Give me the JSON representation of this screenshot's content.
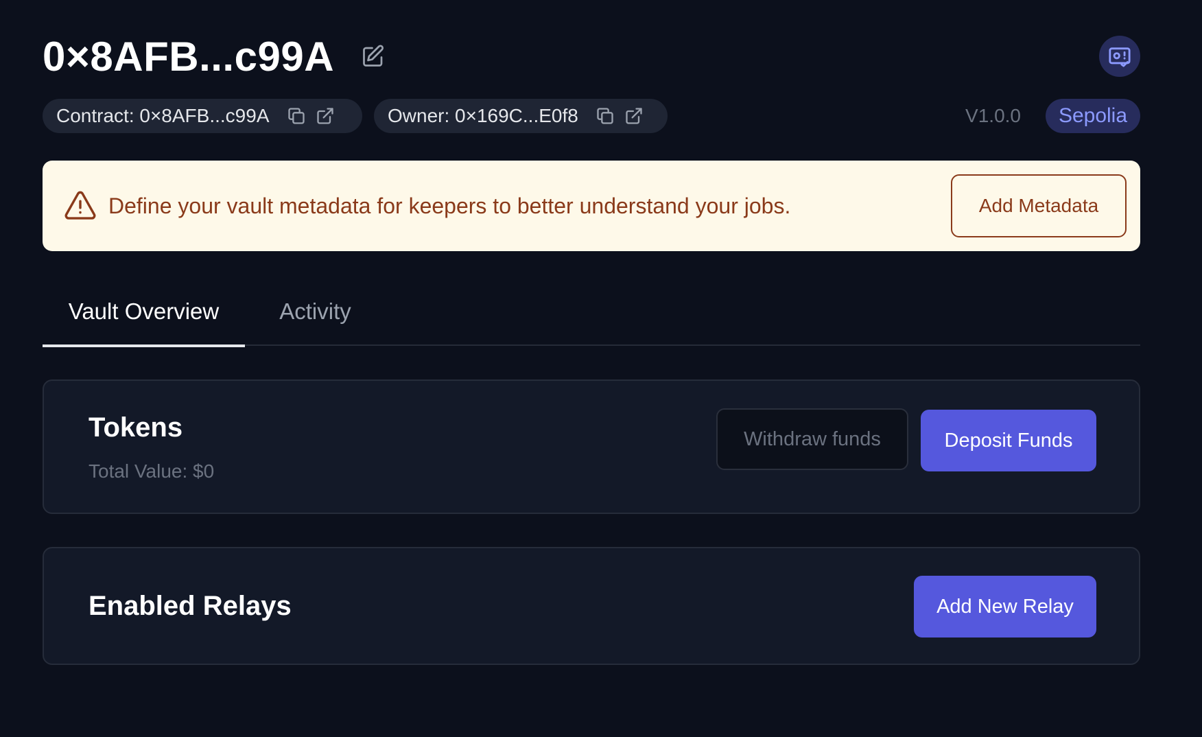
{
  "header": {
    "title": "0×8AFB...c99A",
    "icons": {
      "edit": "edit-icon",
      "top_right": "vault-check-icon"
    }
  },
  "meta": {
    "contract_label": "Contract: 0×8AFB...c99A",
    "owner_label": "Owner: 0×169C...E0f8",
    "version": "V1.0.0",
    "network": "Sepolia"
  },
  "banner": {
    "icon": "warning-icon",
    "message": "Define your vault metadata for keepers to better understand your jobs.",
    "button_label": "Add Metadata"
  },
  "tabs": [
    {
      "label": "Vault Overview",
      "active": true
    },
    {
      "label": "Activity",
      "active": false
    }
  ],
  "tokens": {
    "title": "Tokens",
    "total_value": "Total Value: $0",
    "withdraw_label": "Withdraw funds",
    "deposit_label": "Deposit Funds"
  },
  "relays": {
    "title": "Enabled Relays",
    "add_label": "Add New Relay"
  },
  "colors": {
    "background": "#0c101c",
    "accent": "#5558dd",
    "network_badge_text": "#8c9aff",
    "banner_background": "#fef9e9",
    "banner_text": "#8a3a1a"
  }
}
